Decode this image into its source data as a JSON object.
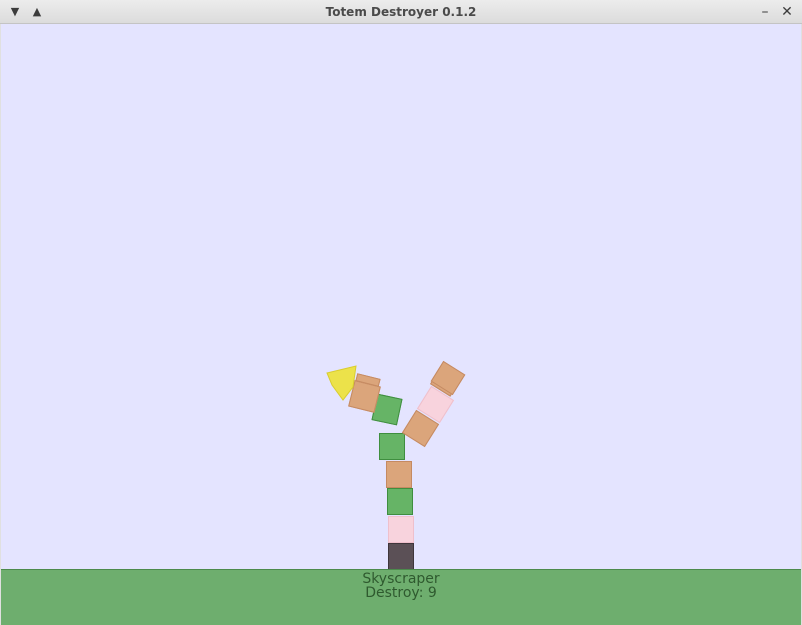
{
  "window": {
    "title": "Totem Destroyer 0.1.2",
    "menu_icon": "chevron-down-icon",
    "shade_icon": "chevron-up-icon",
    "minimize_icon": "minimize-icon",
    "close_icon": "close-icon"
  },
  "game": {
    "level_name": "Skyscraper",
    "destroy_label": "Destroy: 9",
    "colors": {
      "sky": "#e4e4ff",
      "ground": "#6eae6e",
      "tan_block": "#dba57b",
      "green_block": "#66b466",
      "pink_block": "#f8d3dd",
      "dark_block": "#5b5056",
      "totem": "#ece24a"
    }
  }
}
